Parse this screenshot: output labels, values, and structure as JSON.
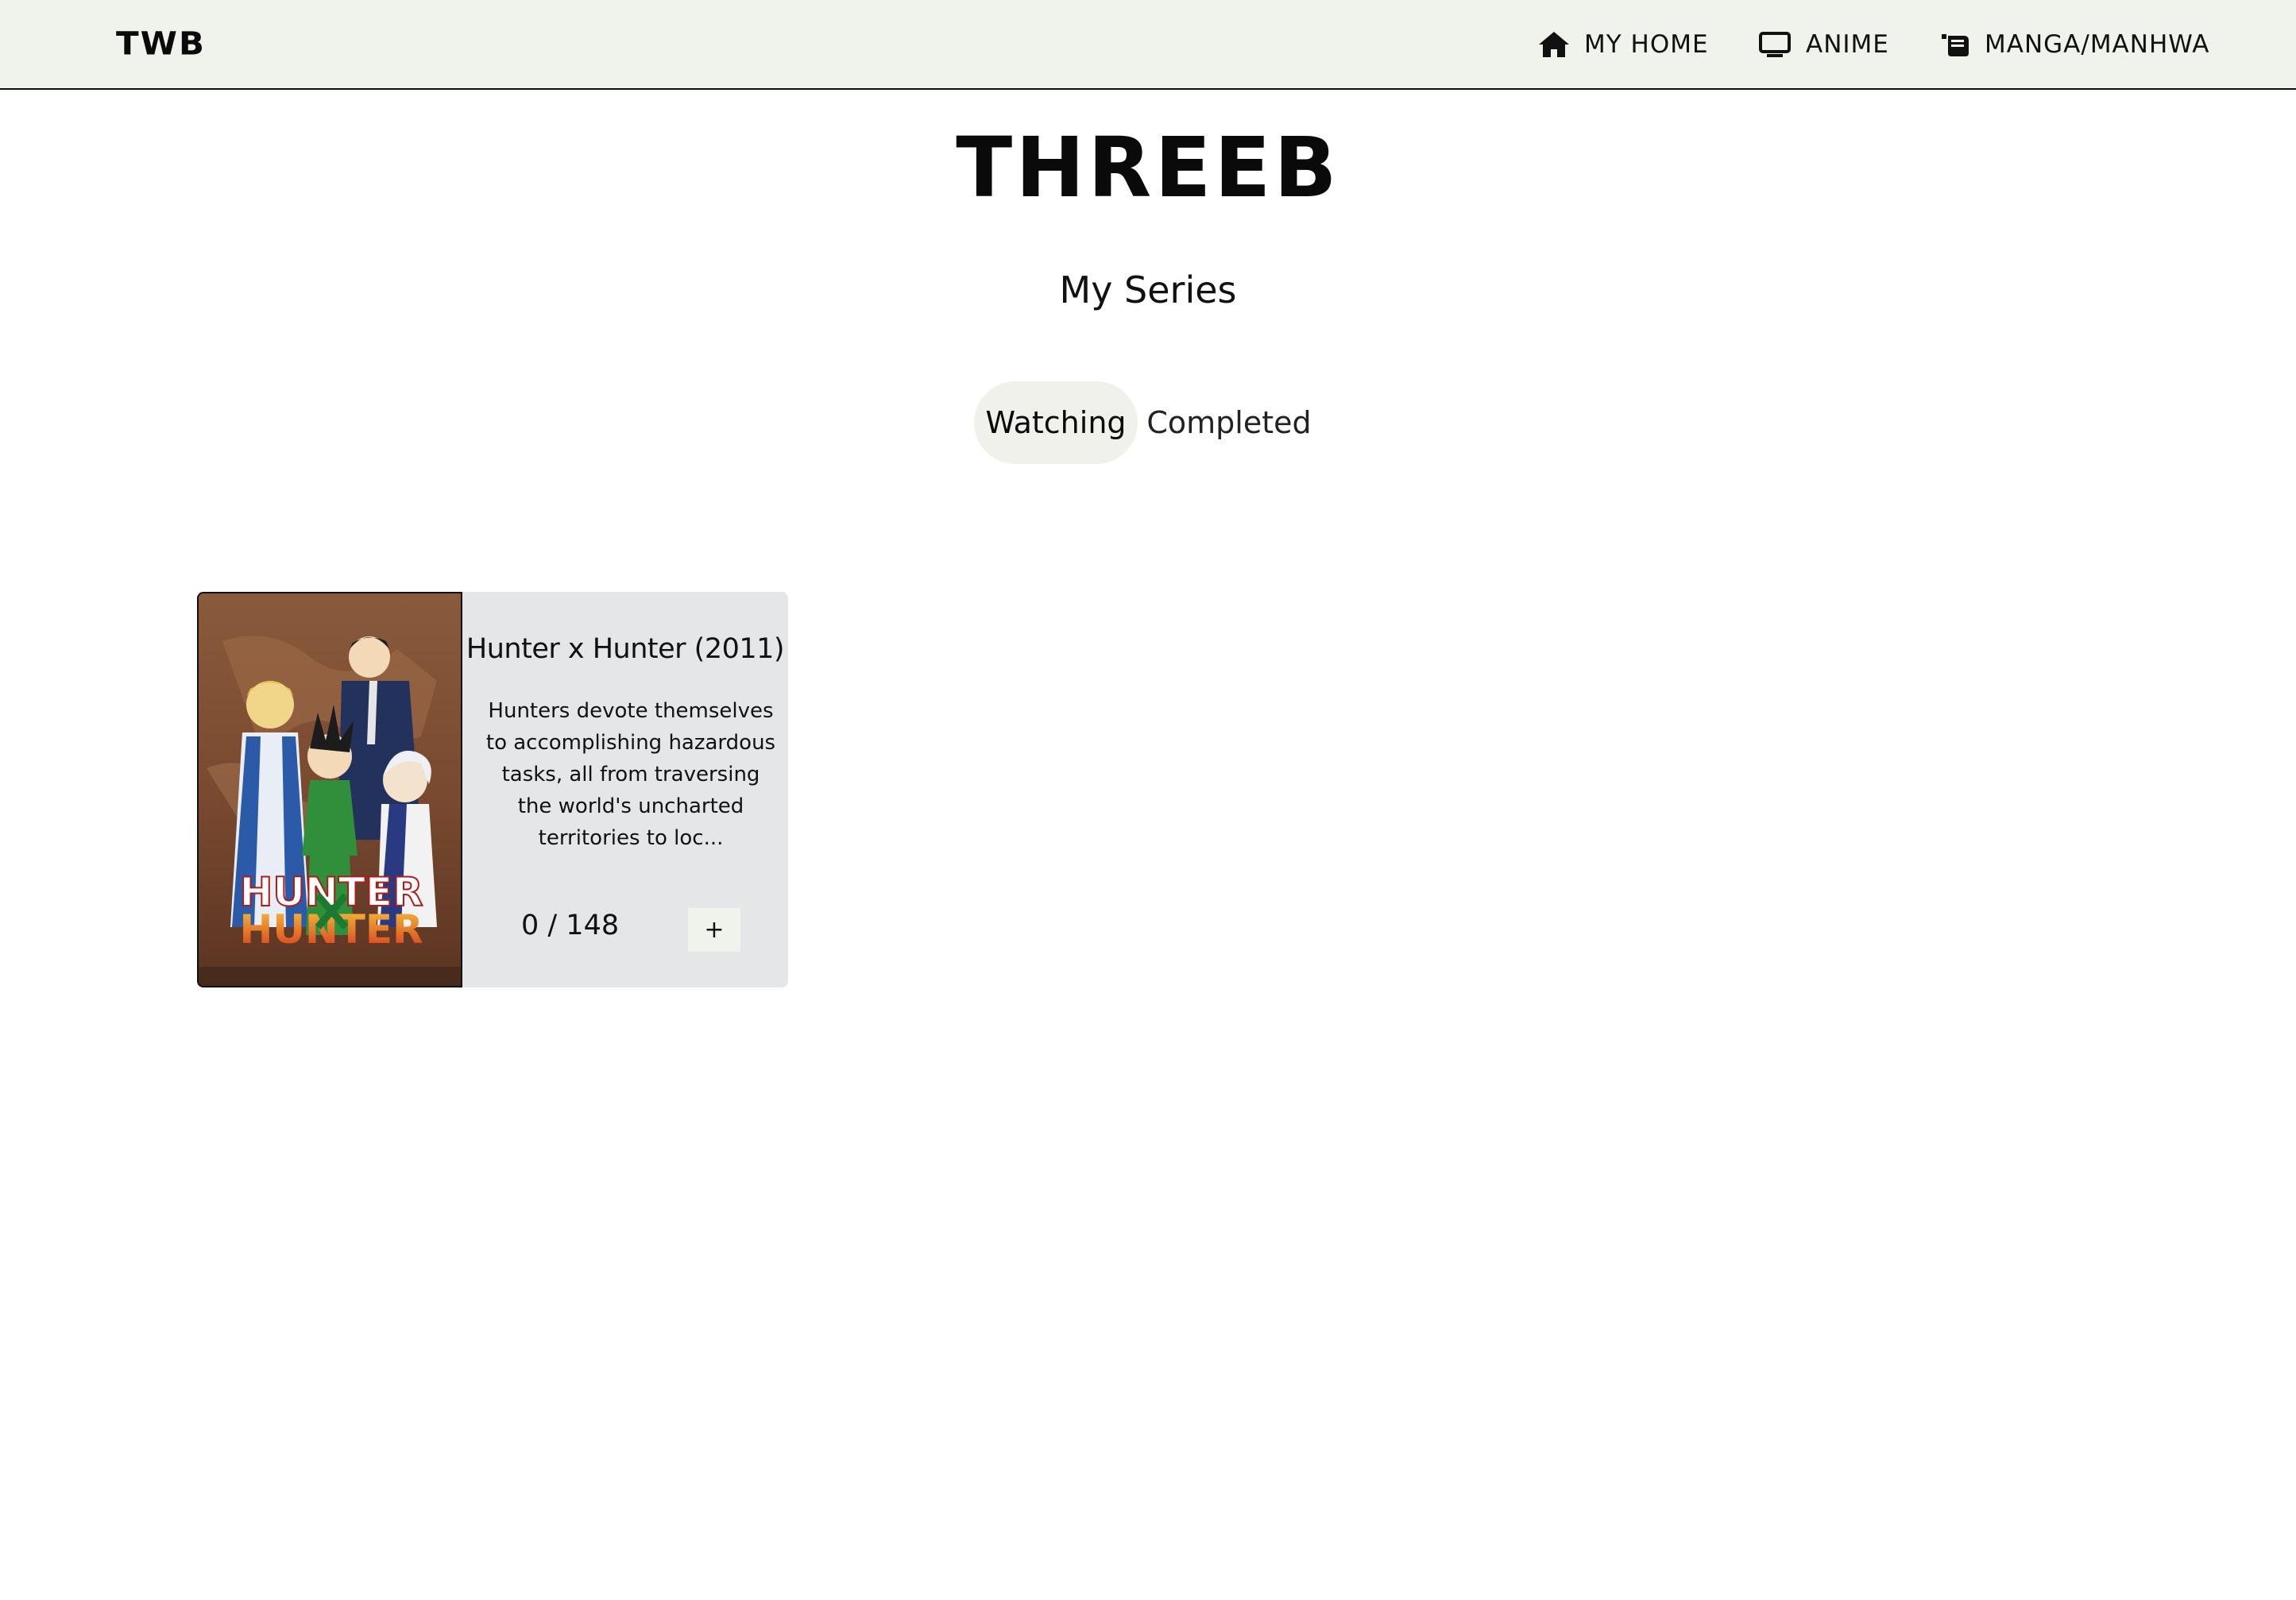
{
  "header": {
    "brand": "TWB",
    "nav": [
      {
        "icon": "home-icon",
        "label": "MY HOME"
      },
      {
        "icon": "tv-icon",
        "label": "ANIME"
      },
      {
        "icon": "book-icon",
        "label": "MANGA/MANHWA"
      }
    ]
  },
  "main": {
    "logo": "THREEB",
    "title": "My Series",
    "tabs": [
      {
        "label": "Watching",
        "active": true
      },
      {
        "label": "Completed",
        "active": false
      }
    ]
  },
  "series": [
    {
      "title": "Hunter x  Hunter (2011)",
      "description": "Hunters devote themselves to accomplishing hazardous tasks, all from traversing the world's uncharted territories to loc...",
      "progress": "0 / 148",
      "add_label": "+",
      "poster_text": "HUNTER"
    }
  ],
  "colors": {
    "topbar_bg": "#f0f2ec",
    "card_bg": "#e5e6e8",
    "tab_active_bg": "#eff1ea"
  }
}
